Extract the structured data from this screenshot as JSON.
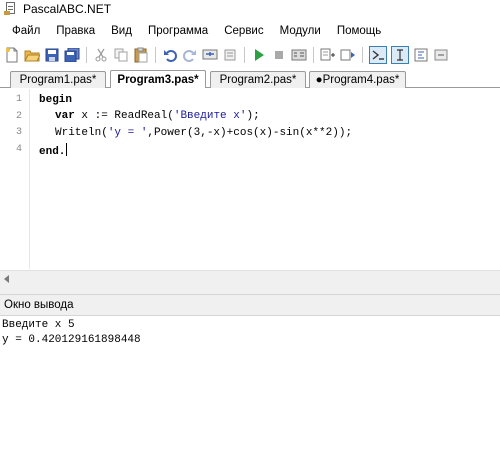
{
  "window": {
    "title": "PascalABC.NET"
  },
  "menu": [
    "Файл",
    "Правка",
    "Вид",
    "Программа",
    "Сервис",
    "Модули",
    "Помощь"
  ],
  "toolbar": {
    "icons": [
      "new-file-icon",
      "open-folder-icon",
      "save-icon",
      "save-all-icon",
      "cut-icon",
      "copy-icon",
      "paste-icon",
      "undo-icon",
      "redo-icon",
      "find-icon",
      "run-icon",
      "stop-icon",
      "compile-icon",
      "debug-icon",
      "step-icon",
      "output-window-icon",
      "text-input-icon",
      "format-icon",
      "settings-icon"
    ]
  },
  "tabs": [
    {
      "label": "Program1.pas*",
      "active": false
    },
    {
      "label": "Program3.pas*",
      "active": true
    },
    {
      "label": "Program2.pas*",
      "active": false
    },
    {
      "label": "●Program4.pas*",
      "active": false
    }
  ],
  "editor": {
    "line_numbers": [
      "1",
      "2",
      "3",
      "4"
    ],
    "lines": [
      {
        "kw1": "begin"
      },
      {
        "kw1": "var",
        "a": " x := ReadReal(",
        "s": "'Введите x'",
        "b": ");"
      },
      {
        "a": "Writeln(",
        "s": "'y = '",
        "b": ",Power(3,-x)+cos(x)-sin(x**2));"
      },
      {
        "kw1": "end."
      }
    ]
  },
  "output": {
    "header": "Окно вывода",
    "lines": [
      "Введите x 5",
      "y = 0.420129161898448"
    ]
  },
  "colors": {
    "string": "#1a1a9c",
    "run_green": "#2ea043",
    "active_toggle": "#3c7fb1"
  }
}
